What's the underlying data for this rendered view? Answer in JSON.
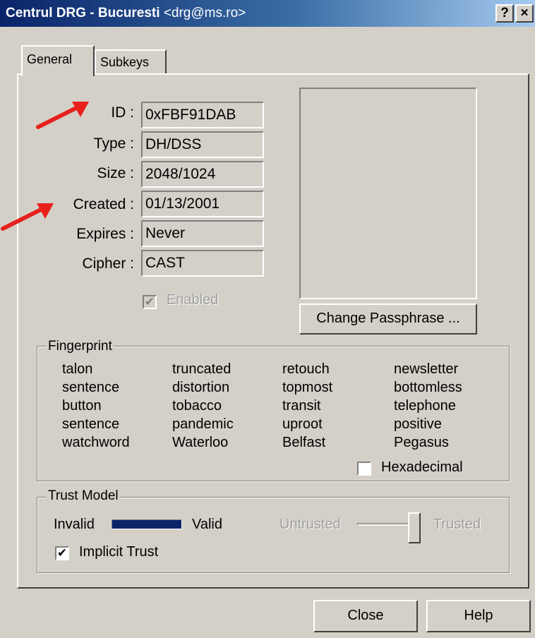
{
  "window": {
    "title": "Centrul DRG - Bucuresti",
    "email": "<drg@ms.ro>",
    "help_button": "?",
    "close_button": "×"
  },
  "tabs": [
    {
      "label": "General",
      "active": true
    },
    {
      "label": "Subkeys",
      "active": false
    }
  ],
  "key_info": {
    "id_label": "ID :",
    "id_value": "0xFBF91DAB",
    "type_label": "Type :",
    "type_value": "DH/DSS",
    "size_label": "Size :",
    "size_value": "2048/1024",
    "created_label": "Created :",
    "created_value": "01/13/2001",
    "expires_label": "Expires :",
    "expires_value": "Never",
    "cipher_label": "Cipher :",
    "cipher_value": "CAST",
    "enabled_label": "Enabled",
    "enabled_checked": true
  },
  "change_passphrase_label": "Change Passphrase ...",
  "fingerprint": {
    "title": "Fingerprint",
    "words": [
      "talon",
      "truncated",
      "retouch",
      "newsletter",
      "sentence",
      "distortion",
      "topmost",
      "bottomless",
      "button",
      "tobacco",
      "transit",
      "telephone",
      "sentence",
      "pandemic",
      "uproot",
      "positive",
      "watchword",
      "Waterloo",
      "Belfast",
      "Pegasus"
    ],
    "hexadecimal_label": "Hexadecimal",
    "hexadecimal_checked": false
  },
  "trust_model": {
    "title": "Trust Model",
    "invalid_label": "Invalid",
    "valid_label": "Valid",
    "validity_fraction": 1.0,
    "untrusted_label": "Untrusted",
    "trusted_label": "Trusted",
    "trust_fraction": 1.0,
    "implicit_trust_label": "Implicit Trust",
    "implicit_trust_checked": true
  },
  "footer": {
    "close_label": "Close",
    "help_label": "Help"
  },
  "colors": {
    "title_bar": "#0a246a",
    "dialog_bg": "#d4d0c8",
    "annotation_arrow": "#e8201b"
  },
  "check_glyph": "✔"
}
